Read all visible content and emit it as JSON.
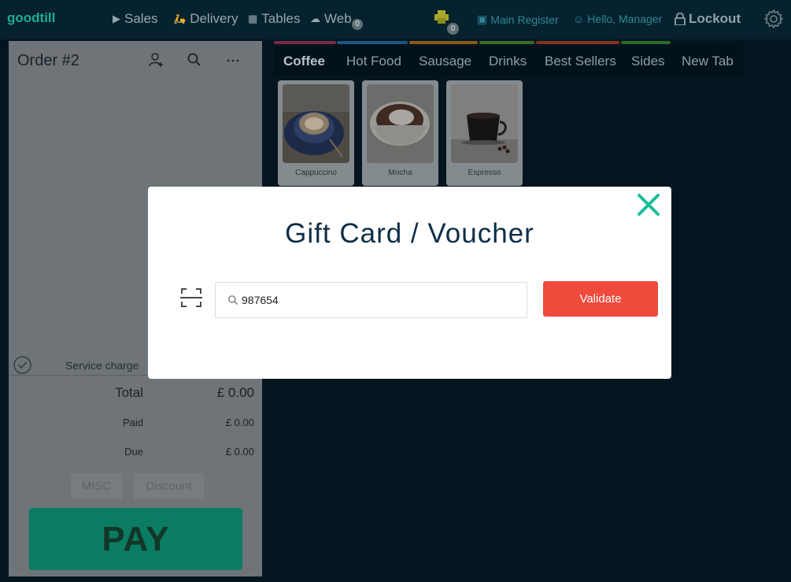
{
  "brand": "goodtill",
  "nav": {
    "sales": "Sales",
    "delivery": "Delivery",
    "tables": "Tables",
    "web": "Web",
    "web_badge": "0",
    "printer_badge": "0",
    "register": "Main Register",
    "greeting": "Hello, Manager",
    "lockout": "Lockout"
  },
  "order": {
    "title": "Order #2",
    "service_charge": "Service charge",
    "total_label": "Total",
    "total_value": "£ 0.00",
    "paid_label": "Paid",
    "paid_value": "£ 0.00",
    "due_label": "Due",
    "due_value": "£ 0.00",
    "misc_label": "MISC",
    "discount_label": "Discount",
    "pay_label": "PAY"
  },
  "tabs": [
    {
      "label": "Coffee",
      "color": "#c63d6e"
    },
    {
      "label": "Hot Food",
      "color": "#2a7fc3"
    },
    {
      "label": "Sausage",
      "color": "#d88a1c"
    },
    {
      "label": "Drinks",
      "color": "#58a736"
    },
    {
      "label": "Best Sellers",
      "color": "#d34d2c"
    },
    {
      "label": "Sides",
      "color": "#3ea53a"
    },
    {
      "label": "New Tab",
      "color": ""
    }
  ],
  "products": [
    {
      "name": "Cappuccino"
    },
    {
      "name": "Mocha"
    },
    {
      "name": "Espresso"
    }
  ],
  "modal": {
    "title": "Gift Card / Voucher",
    "input_value": "987654",
    "validate_label": "Validate"
  },
  "colors": {
    "accent_teal": "#1aae8f",
    "validate_red": "#ef4a3c",
    "modal_title": "#0e2e45"
  }
}
